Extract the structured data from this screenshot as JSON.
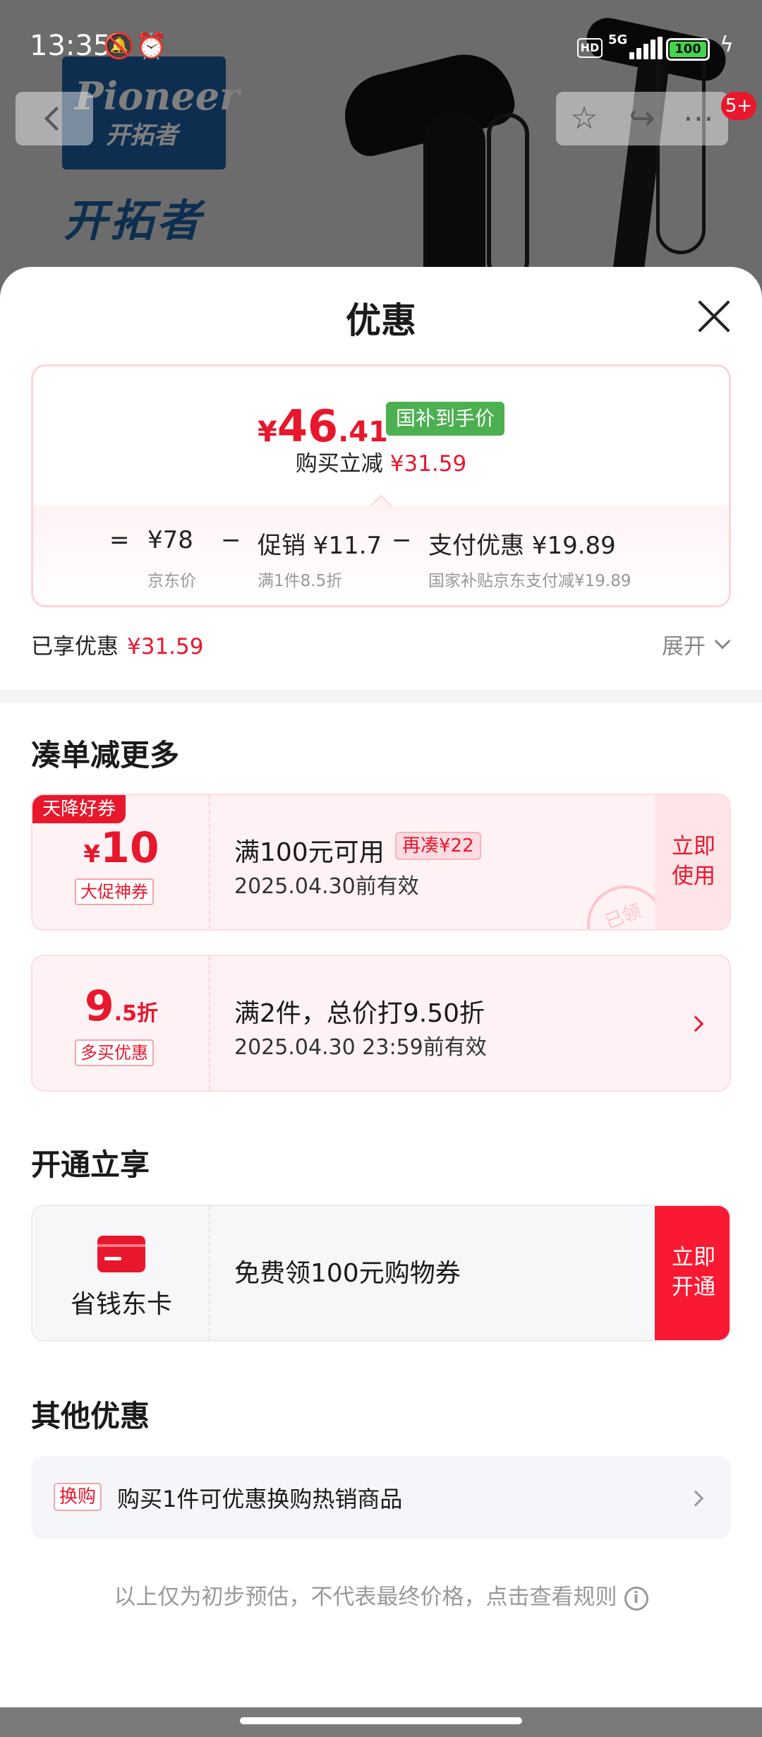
{
  "status_bar": {
    "time": "13:35",
    "hd": "HD",
    "network": "5G",
    "battery": "100"
  },
  "background": {
    "brand_en": "Pioneer",
    "brand_cn_small": "开拓者",
    "brand_cn": "开拓者",
    "cart_badge": "5+"
  },
  "sheet": {
    "title": "优惠",
    "price": {
      "currency": "¥",
      "integer": "46",
      "decimal": ".41",
      "tag": "国补到手价",
      "instant_label": "购买立减",
      "instant_amount": "¥31.59",
      "equals": "=",
      "base_value": "¥78",
      "base_label": "京东价",
      "minus1": "−",
      "promo_value": "促销 ¥11.7",
      "promo_label": "满1件8.5折",
      "minus2": "−",
      "pay_value": "支付优惠 ¥19.89",
      "pay_label": "国家补贴京东支付减¥19.89"
    },
    "enjoyed_label": "已享优惠",
    "enjoyed_amount": "¥31.59",
    "expand_label": "展开",
    "section_more": "凑单减更多",
    "coupon1": {
      "corner_tag": "天降好券",
      "currency": "¥",
      "value": "10",
      "type_tag": "大促神券",
      "title": "满100元可用",
      "extra_tag": "再凑¥22",
      "validity": "2025.04.30前有效",
      "button": "立即\n使用",
      "stamp": "已领"
    },
    "coupon2": {
      "value_int": "9",
      "value_dec": ".5折",
      "type_tag": "多买优惠",
      "title": "满2件，总价打9.50折",
      "validity": "2025.04.30 23:59前有效"
    },
    "section_open": "开通立享",
    "member": {
      "name": "省钱东卡",
      "desc": "免费领100元购物券",
      "button": "立即\n开通"
    },
    "section_other": "其他优惠",
    "other": {
      "tag": "换购",
      "text": "购买1件可优惠换购热销商品"
    },
    "disclaimer": "以上仅为初步预估，不代表最终价格，点击查看规则"
  },
  "icons": {
    "info": "i",
    "star": "☆",
    "share": "↪",
    "more": "⋯",
    "mute": "🔕",
    "alarm": "⏰",
    "bolt": "ϟ"
  },
  "colors": {
    "accent_red": "#e8172c",
    "green_tag": "#4caf50"
  }
}
